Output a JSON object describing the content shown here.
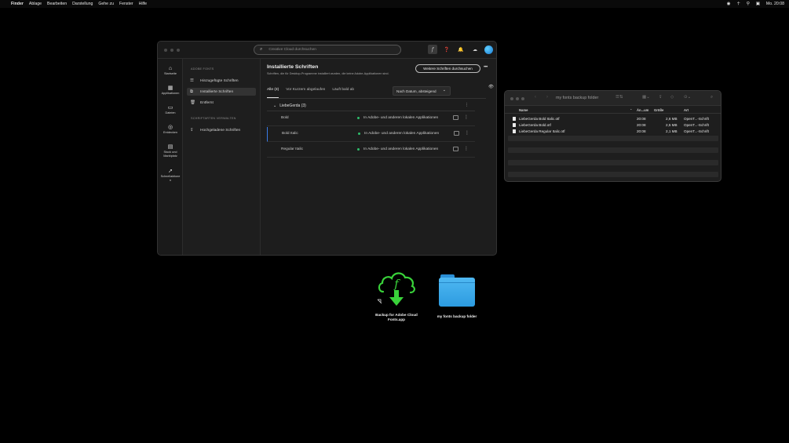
{
  "menubar": {
    "apple": "",
    "items": [
      "Finder",
      "Ablage",
      "Bearbeiten",
      "Darstellung",
      "Gehe zu",
      "Fenster",
      "Hilfe"
    ],
    "clock": "Mo. 20:08"
  },
  "cc": {
    "search_placeholder": "Creative Cloud durchsuchen",
    "rail": [
      {
        "icon": "home-icon",
        "glyph": "⌂",
        "label": "Startseite"
      },
      {
        "icon": "apps-icon",
        "glyph": "▦",
        "label": "Applikationen"
      },
      {
        "icon": "folder-icon",
        "glyph": "▭",
        "label": "Dateien"
      },
      {
        "icon": "discover-icon",
        "glyph": "◎",
        "label": "Entdecken"
      },
      {
        "icon": "stock-icon",
        "glyph": "▤",
        "label": "Stock und Marktplatz"
      },
      {
        "icon": "quick-actions-icon",
        "glyph": "➚",
        "label": "Schnellaktionen"
      }
    ],
    "sidebar": {
      "section1": "ADOBE FONTS",
      "items1": [
        "Hinzugefügte Schriften",
        "Installierte Schriften",
        "Entfernt"
      ],
      "section2": "SCHRIFTARTEN VERWALTEN",
      "items2": [
        "Hochgeladene Schriften"
      ]
    },
    "header": {
      "title": "Installierte Schriften",
      "subtitle": "Schriften, die für Desktop-Programme installiert wurden, die keine Adobe-Applikationen sind.",
      "button": "Weitere Schriften durchsuchen"
    },
    "tabs": [
      "Alle (3)",
      "Vor Kurzem abgelaufen",
      "Läuft bald ab"
    ],
    "sort": "Nach Datum, absteigend",
    "group": "LiebeGerda (3)",
    "rows": [
      {
        "name": "Bold",
        "status": "In Adobe- und anderen lokalen Applikationen"
      },
      {
        "name": "Bold Italic",
        "status": "In Adobe- und anderen lokalen Applikationen"
      },
      {
        "name": "Regular Italic",
        "status": "In Adobe- und anderen lokalen Applikationen"
      }
    ]
  },
  "finder": {
    "title": "my fonts backup folder",
    "columns": {
      "name": "Name",
      "date": "Än...um",
      "size": "Größe",
      "kind": "Art"
    },
    "files": [
      {
        "name": "LiebeGerda Bold Italic.otf",
        "date": "20:08",
        "size": "2,6 MB",
        "kind": "OpenT...-Schrift"
      },
      {
        "name": "LiebeGerda Bold.otf",
        "date": "20:08",
        "size": "2,5 MB",
        "kind": "OpenT...-Schrift"
      },
      {
        "name": "LiebeGerda Regular Italic.otf",
        "date": "20:08",
        "size": "2,1 MB",
        "kind": "OpenT...-Schrift"
      }
    ]
  },
  "desktop": {
    "app_label": "Backup for Adobe Cloud Fonts.app",
    "folder_label": "my fonts backup folder"
  },
  "colors": {
    "accent": "#3a7be6",
    "status_green": "#2ebd6b",
    "app_icon_green": "#39d23a",
    "folder_blue": "#3aa9ec"
  }
}
